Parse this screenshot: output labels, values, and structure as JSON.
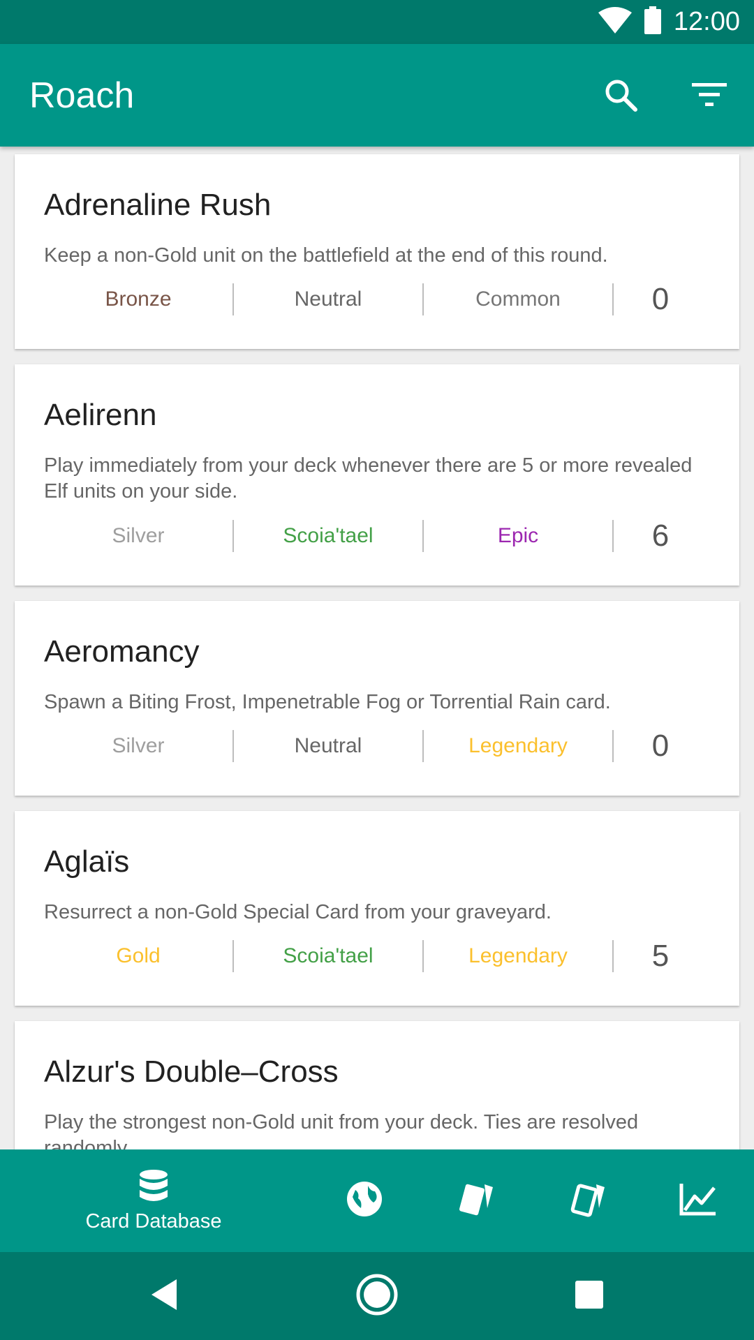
{
  "status_bar": {
    "time": "12:00"
  },
  "app_bar": {
    "title": "Roach",
    "search_icon": "search-icon",
    "filter_icon": "filter-icon"
  },
  "cards": [
    {
      "name": "Adrenaline Rush",
      "description": "Keep a non-Gold unit on the battlefield at the end of this round.",
      "rarity_tier": "Bronze",
      "faction": "Neutral",
      "rarity": "Common",
      "cost": "0",
      "colors": {
        "tier": "#795548",
        "faction": "#666666",
        "rarity": "#757575"
      }
    },
    {
      "name": "Aelirenn",
      "description": "Play immediately from your deck whenever there are 5 or more revealed Elf units on your side.",
      "rarity_tier": "Silver",
      "faction": "Scoia'tael",
      "rarity": "Epic",
      "cost": "6",
      "colors": {
        "tier": "#9e9e9e",
        "faction": "#43a047",
        "rarity": "#9c27b0"
      }
    },
    {
      "name": "Aeromancy",
      "description": "Spawn a Biting Frost, Impenetrable Fog or Torrential Rain card.",
      "rarity_tier": "Silver",
      "faction": "Neutral",
      "rarity": "Legendary",
      "cost": "0",
      "colors": {
        "tier": "#9e9e9e",
        "faction": "#666666",
        "rarity": "#fbc02d"
      }
    },
    {
      "name": "Aglaïs",
      "description": "Resurrect a non-Gold Special Card from your graveyard.",
      "rarity_tier": "Gold",
      "faction": "Scoia'tael",
      "rarity": "Legendary",
      "cost": "5",
      "colors": {
        "tier": "#fbc02d",
        "faction": "#43a047",
        "rarity": "#fbc02d"
      }
    },
    {
      "name": "Alzur's Double–Cross",
      "description": "Play the strongest non-Gold unit from your deck. Ties are resolved randomly."
    }
  ],
  "bottom_nav": {
    "active_label": "Card Database",
    "items": [
      "database-icon",
      "globe-icon",
      "card-icon",
      "card-outline-icon",
      "chart-icon"
    ]
  },
  "system_nav": [
    "back-icon",
    "home-icon",
    "recents-icon"
  ]
}
